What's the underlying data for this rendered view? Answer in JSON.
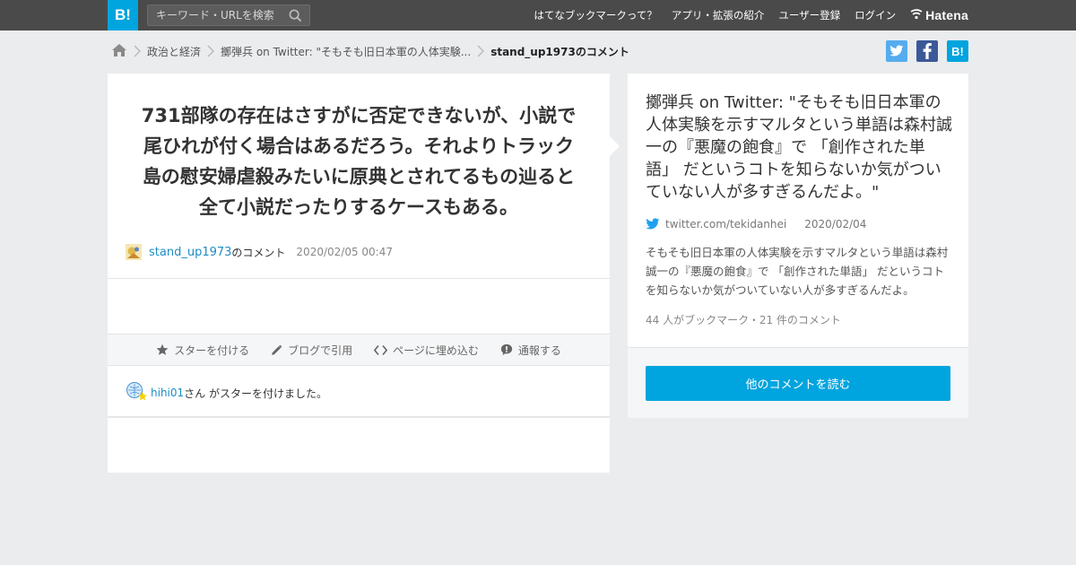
{
  "header": {
    "logo_text": "B!",
    "search_placeholder": "キーワード・URLを検索",
    "nav": [
      {
        "label": "はてなブックマークって？"
      },
      {
        "label": "アプリ・拡張の紹介"
      },
      {
        "label": "ユーザー登録"
      },
      {
        "label": "ログイン"
      }
    ],
    "brand": "Hatena"
  },
  "breadcrumb": {
    "items": [
      {
        "label": "政治と経済"
      },
      {
        "label": "擲弾兵 on Twitter: \"そもそも旧日本軍の人体実験..."
      }
    ],
    "current": "stand_up1973のコメント"
  },
  "share": {
    "twitter_color": "#55acee",
    "facebook_color": "#3b5998",
    "hatena_color": "#00a4de",
    "hatena_label": "B!"
  },
  "comment": {
    "text": "731部隊の存在はさすがに否定できないが、小説で尾ひれが付く場合はあるだろう。それよりトラック島の慰安婦虐殺みたいに原典とされてるもの辿ると全て小説だったりするケースもある。",
    "user": "stand_up1973",
    "user_suffix": "のコメント",
    "timestamp": "2020/02/05 00:47"
  },
  "actions": [
    {
      "label": "スターを付ける",
      "icon": "star-icon"
    },
    {
      "label": "ブログで引用",
      "icon": "pencil-icon"
    },
    {
      "label": "ページに埋め込む",
      "icon": "code-icon"
    },
    {
      "label": "通報する",
      "icon": "alert-icon"
    }
  ],
  "star_notice": {
    "user": "hihi01",
    "text": "さん がスターを付けました。"
  },
  "entry": {
    "title": "擲弾兵 on Twitter: \"そもそも旧日本軍の人体実験を示すマルタという単語は森村誠一の『悪魔の飽食』で 「創作された単語」 だというコトを知らないか気がついていない人が多すぎるんだよ。\"",
    "domain": "twitter.com/tekidanhei",
    "date": "2020/02/04",
    "description": "そもそも旧日本軍の人体実験を示すマルタという単語は森村誠一の『悪魔の飽食』で 「創作された単語」 だというコトを知らないか気がついていない人が多すぎるんだよ。",
    "counts": "44 人がブックマーク・21 件のコメント",
    "read_more": "他のコメントを読む"
  },
  "colors": {
    "accent": "#00a4de",
    "link": "#1a8ec5",
    "topbar": "#4a4a4a",
    "background": "#ebecee"
  }
}
